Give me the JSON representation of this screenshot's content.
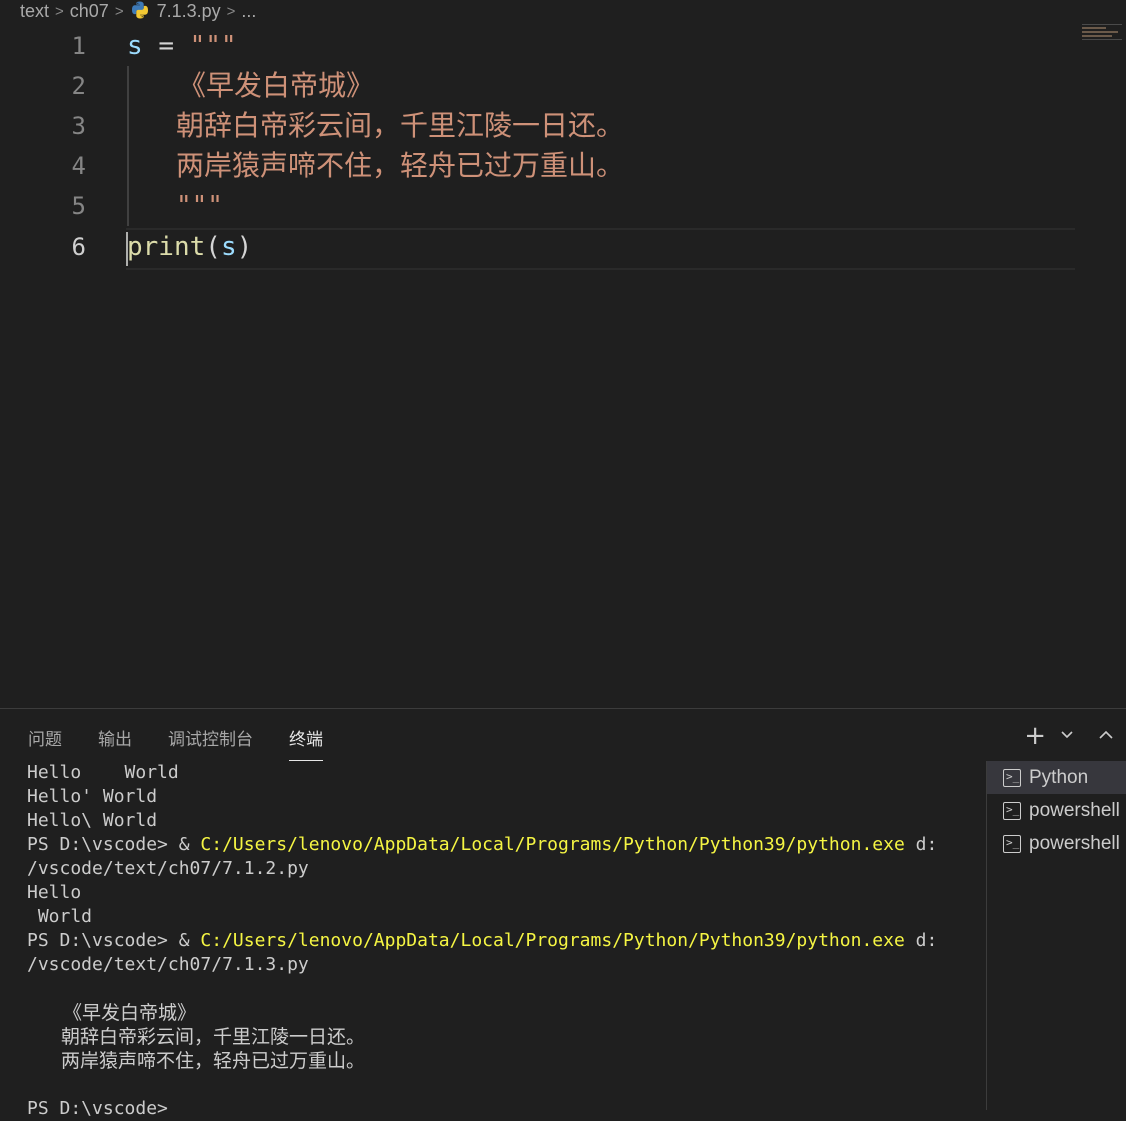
{
  "breadcrumb": {
    "items": [
      "text",
      "ch07",
      "7.1.3.py",
      "..."
    ],
    "separator": ">"
  },
  "editor": {
    "lines": [
      {
        "number": "1",
        "parts": [
          "s",
          "=",
          "\"\"\""
        ]
      },
      {
        "number": "2",
        "text": "《早发白帝城》"
      },
      {
        "number": "3",
        "text": "朝辞白帝彩云间，千里江陵一日还。"
      },
      {
        "number": "4",
        "text": "两岸猿声啼不住，轻舟已过万重山。"
      },
      {
        "number": "5",
        "text": "\"\"\""
      },
      {
        "number": "6",
        "parts": [
          "print",
          "(",
          "s",
          ")"
        ]
      }
    ]
  },
  "panel": {
    "tabs": [
      "问题",
      "输出",
      "调试控制台",
      "终端"
    ],
    "active_tab": "终端",
    "add_icon": "plus-icon",
    "dropdown_icon": "chevron-down-icon",
    "maximize_icon": "chevron-up-icon"
  },
  "terminal": {
    "lines": [
      "Hello    World",
      "Hello' World",
      "Hello\\ World"
    ],
    "cmd1": {
      "prompt": "PS D:\\vscode> & ",
      "exe": "C:/Users/lenovo/AppData/Local/Programs/Python/Python39/python.exe",
      "arg_start": " d:",
      "arg_rest": "/vscode/text/ch07/7.1.2.py"
    },
    "out1": [
      "Hello",
      " World"
    ],
    "cmd2": {
      "prompt": "PS D:\\vscode> & ",
      "exe": "C:/Users/lenovo/AppData/Local/Programs/Python/Python39/python.exe",
      "arg_start": " d:",
      "arg_rest": "/vscode/text/ch07/7.1.3.py"
    },
    "poem": [
      "《早发白帝城》",
      "朝辞白帝彩云间，千里江陵一日还。",
      "两岸猿声啼不住，轻舟已过万重山。"
    ],
    "last_prompt": "PS D:\\vscode>"
  },
  "terminal_list": {
    "items": [
      {
        "label": "Python",
        "icon": "terminal-icon",
        "selected": true
      },
      {
        "label": "powershell",
        "icon": "terminal-icon",
        "selected": false
      },
      {
        "label": "powershell",
        "icon": "terminal-icon",
        "selected": false
      }
    ]
  },
  "colors": {
    "background": "#1f1f1f",
    "string": "#ce9178",
    "variable": "#9cdcfe",
    "function": "#dcdcaa",
    "path": "#f5f543"
  }
}
